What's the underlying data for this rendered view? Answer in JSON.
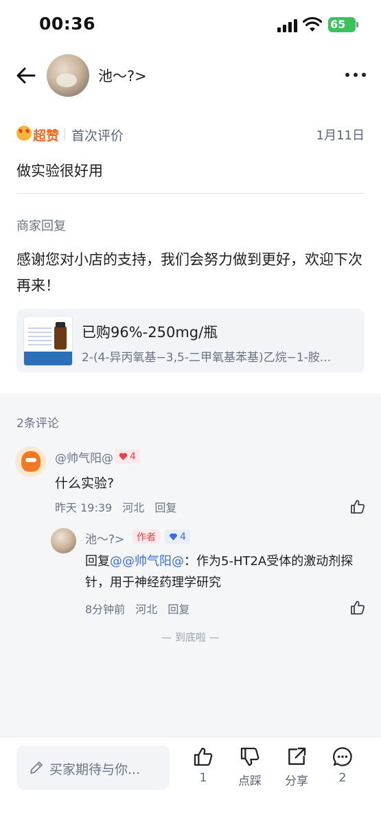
{
  "status_bar": {
    "time": "00:36",
    "battery": "65"
  },
  "nav": {
    "username": "池～?>"
  },
  "review": {
    "badge": "超赞",
    "rating_label": "首次评价",
    "date": "1月11日",
    "text": "做实验很好用"
  },
  "merchant_reply": {
    "title": "商家回复",
    "text": "感谢您对小店的支持，我们会努力做到更好，欢迎下次再来！"
  },
  "product": {
    "title": "已购96%-250mg/瓶",
    "subtitle": "2-(4-异丙氧基−3,5-二甲氧基苯基)乙烷−1-胺..."
  },
  "comments": {
    "count": "2条评论",
    "items": [
      {
        "user": "@帅气阳@",
        "level": "4",
        "text": "什么实验?",
        "time": "昨天 19:39",
        "location": "河北",
        "reply": "回复"
      },
      {
        "user": "池～?>",
        "author_tag": "作者",
        "level": "4",
        "prefix": "回复",
        "mention": "@@帅气阳@",
        "text": "：作为5-HT2A受体的激动剂探针，用于神经药理学研究",
        "time": "8分钟前",
        "location": "河北",
        "reply": "回复"
      }
    ],
    "end_mark": "— 到底啦 —"
  },
  "bottom_bar": {
    "input_placeholder": "买家期待与你...",
    "like_count": "1",
    "dislike_label": "点踩",
    "share_label": "分享",
    "comment_count": "2"
  },
  "colors": {
    "accent_orange": "#f06a1f",
    "mention_blue": "#3c6ee0",
    "level_red": "#e8414f",
    "battery_green": "#3cc25c"
  }
}
